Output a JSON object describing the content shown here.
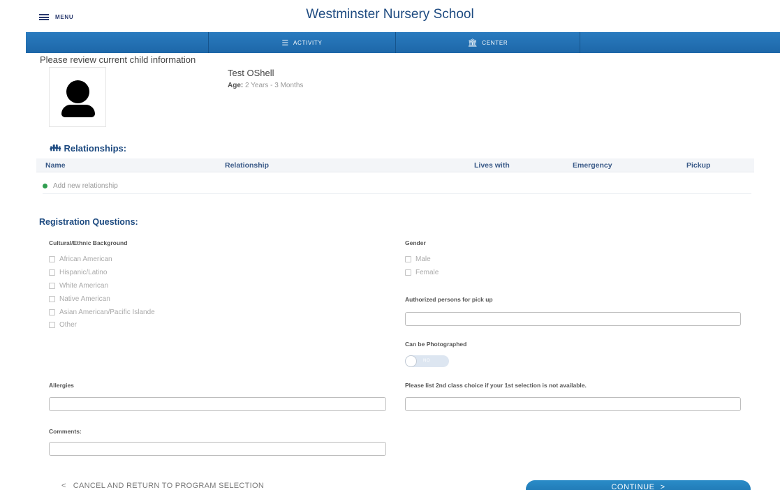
{
  "header": {
    "menu_label": "MENU",
    "site_title": "Westminster Nursery School",
    "menu_icon": "hamburger-icon"
  },
  "nav": {
    "activity_label": "ACTIVITY",
    "activity_icon": "list-icon",
    "center_label": "CENTER",
    "center_icon": "building-icon"
  },
  "child": {
    "review_prompt": "Please review current child information",
    "name": "Test OShell",
    "age_label": "Age:",
    "age_value": "2 Years - 3 Months",
    "photo_icon": "person-placeholder-icon"
  },
  "relationships": {
    "heading": "Relationships:",
    "heading_icon": "family-icon",
    "columns": [
      "Name",
      "Relationship",
      "Lives with",
      "Emergency",
      "Pickup"
    ],
    "rows": [],
    "add_label": "Add new relationship"
  },
  "registration": {
    "heading": "Registration Questions:",
    "ethnic_label": "Cultural/Ethnic Background",
    "ethnic_options": [
      "African American",
      "Hispanic/Latino",
      "White American",
      "Native American",
      "Asian American/Pacific Islande",
      "Other"
    ],
    "gender_label": "Gender",
    "gender_options": [
      "Male",
      "Female"
    ],
    "pickup_label": "Authorized persons for pick up",
    "pickup_value": "",
    "photo_label": "Can be Photographed",
    "photo_toggle_text": "NO",
    "allergies_label": "Allergies",
    "allergies_value": "",
    "second_choice_label": "Please list 2nd class choice if your 1st selection is not available.",
    "second_choice_value": "",
    "comments_label": "Comments:",
    "comments_value": ""
  },
  "footer": {
    "cancel_label": "CANCEL AND RETURN TO PROGRAM SELECTION",
    "continue_label": "CONTINUE",
    "back_icon": "chevron-left-icon",
    "forward_icon": "chevron-right-icon"
  },
  "colors": {
    "nav_blue": "#1d67a8",
    "heading_blue": "#1d4a80",
    "add_green": "#2f9e4f",
    "button_blue": "#1b6fab"
  }
}
